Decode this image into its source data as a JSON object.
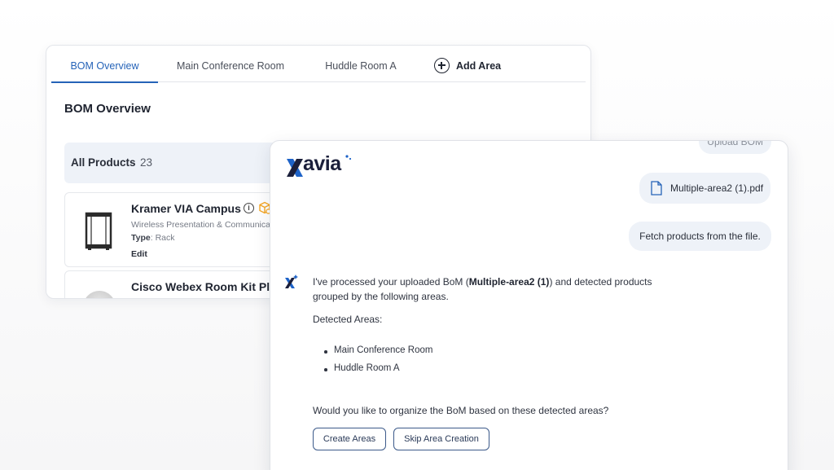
{
  "bom": {
    "tabs": [
      {
        "label": "BOM Overview",
        "active": true
      },
      {
        "label": "Main Conference Room",
        "active": false
      },
      {
        "label": "Huddle Room A",
        "active": false
      }
    ],
    "add_area_label": "Add Area",
    "title": "BOM Overview",
    "all_products_label": "All Products",
    "all_products_count": "23",
    "products": [
      {
        "name": "Kramer VIA Campus",
        "description": "Wireless Presentation & Communica",
        "type_label": "Type",
        "type_value": ": Rack",
        "edit_label": "Edit"
      },
      {
        "name": "Cisco Webex Room Kit Plu"
      }
    ]
  },
  "chat": {
    "logo_text": "avia",
    "upload_bubble": "Upload BOM",
    "file_bubble": "Multiple-area2 (1).pdf",
    "fetch_bubble": "Fetch products from the file.",
    "bot_message_prefix": "I've processed your uploaded BoM (",
    "bot_message_bold": "Multiple-area2 (1)",
    "bot_message_suffix": ") and detected products grouped by the following areas.",
    "detected_areas_label": "Detected Areas:",
    "areas": [
      "Main Conference Room",
      "Huddle Room A"
    ],
    "question": "Would you like to organize the BoM based on these detected areas?",
    "create_button": "Create Areas",
    "skip_button": "Skip Area Creation"
  },
  "colors": {
    "accent": "#2563b8",
    "bubble_bg": "#eef2f8",
    "logo_blue": "#1e63c8",
    "logo_dark": "#1b1f3b",
    "box_icon_orange": "#f5a623"
  }
}
